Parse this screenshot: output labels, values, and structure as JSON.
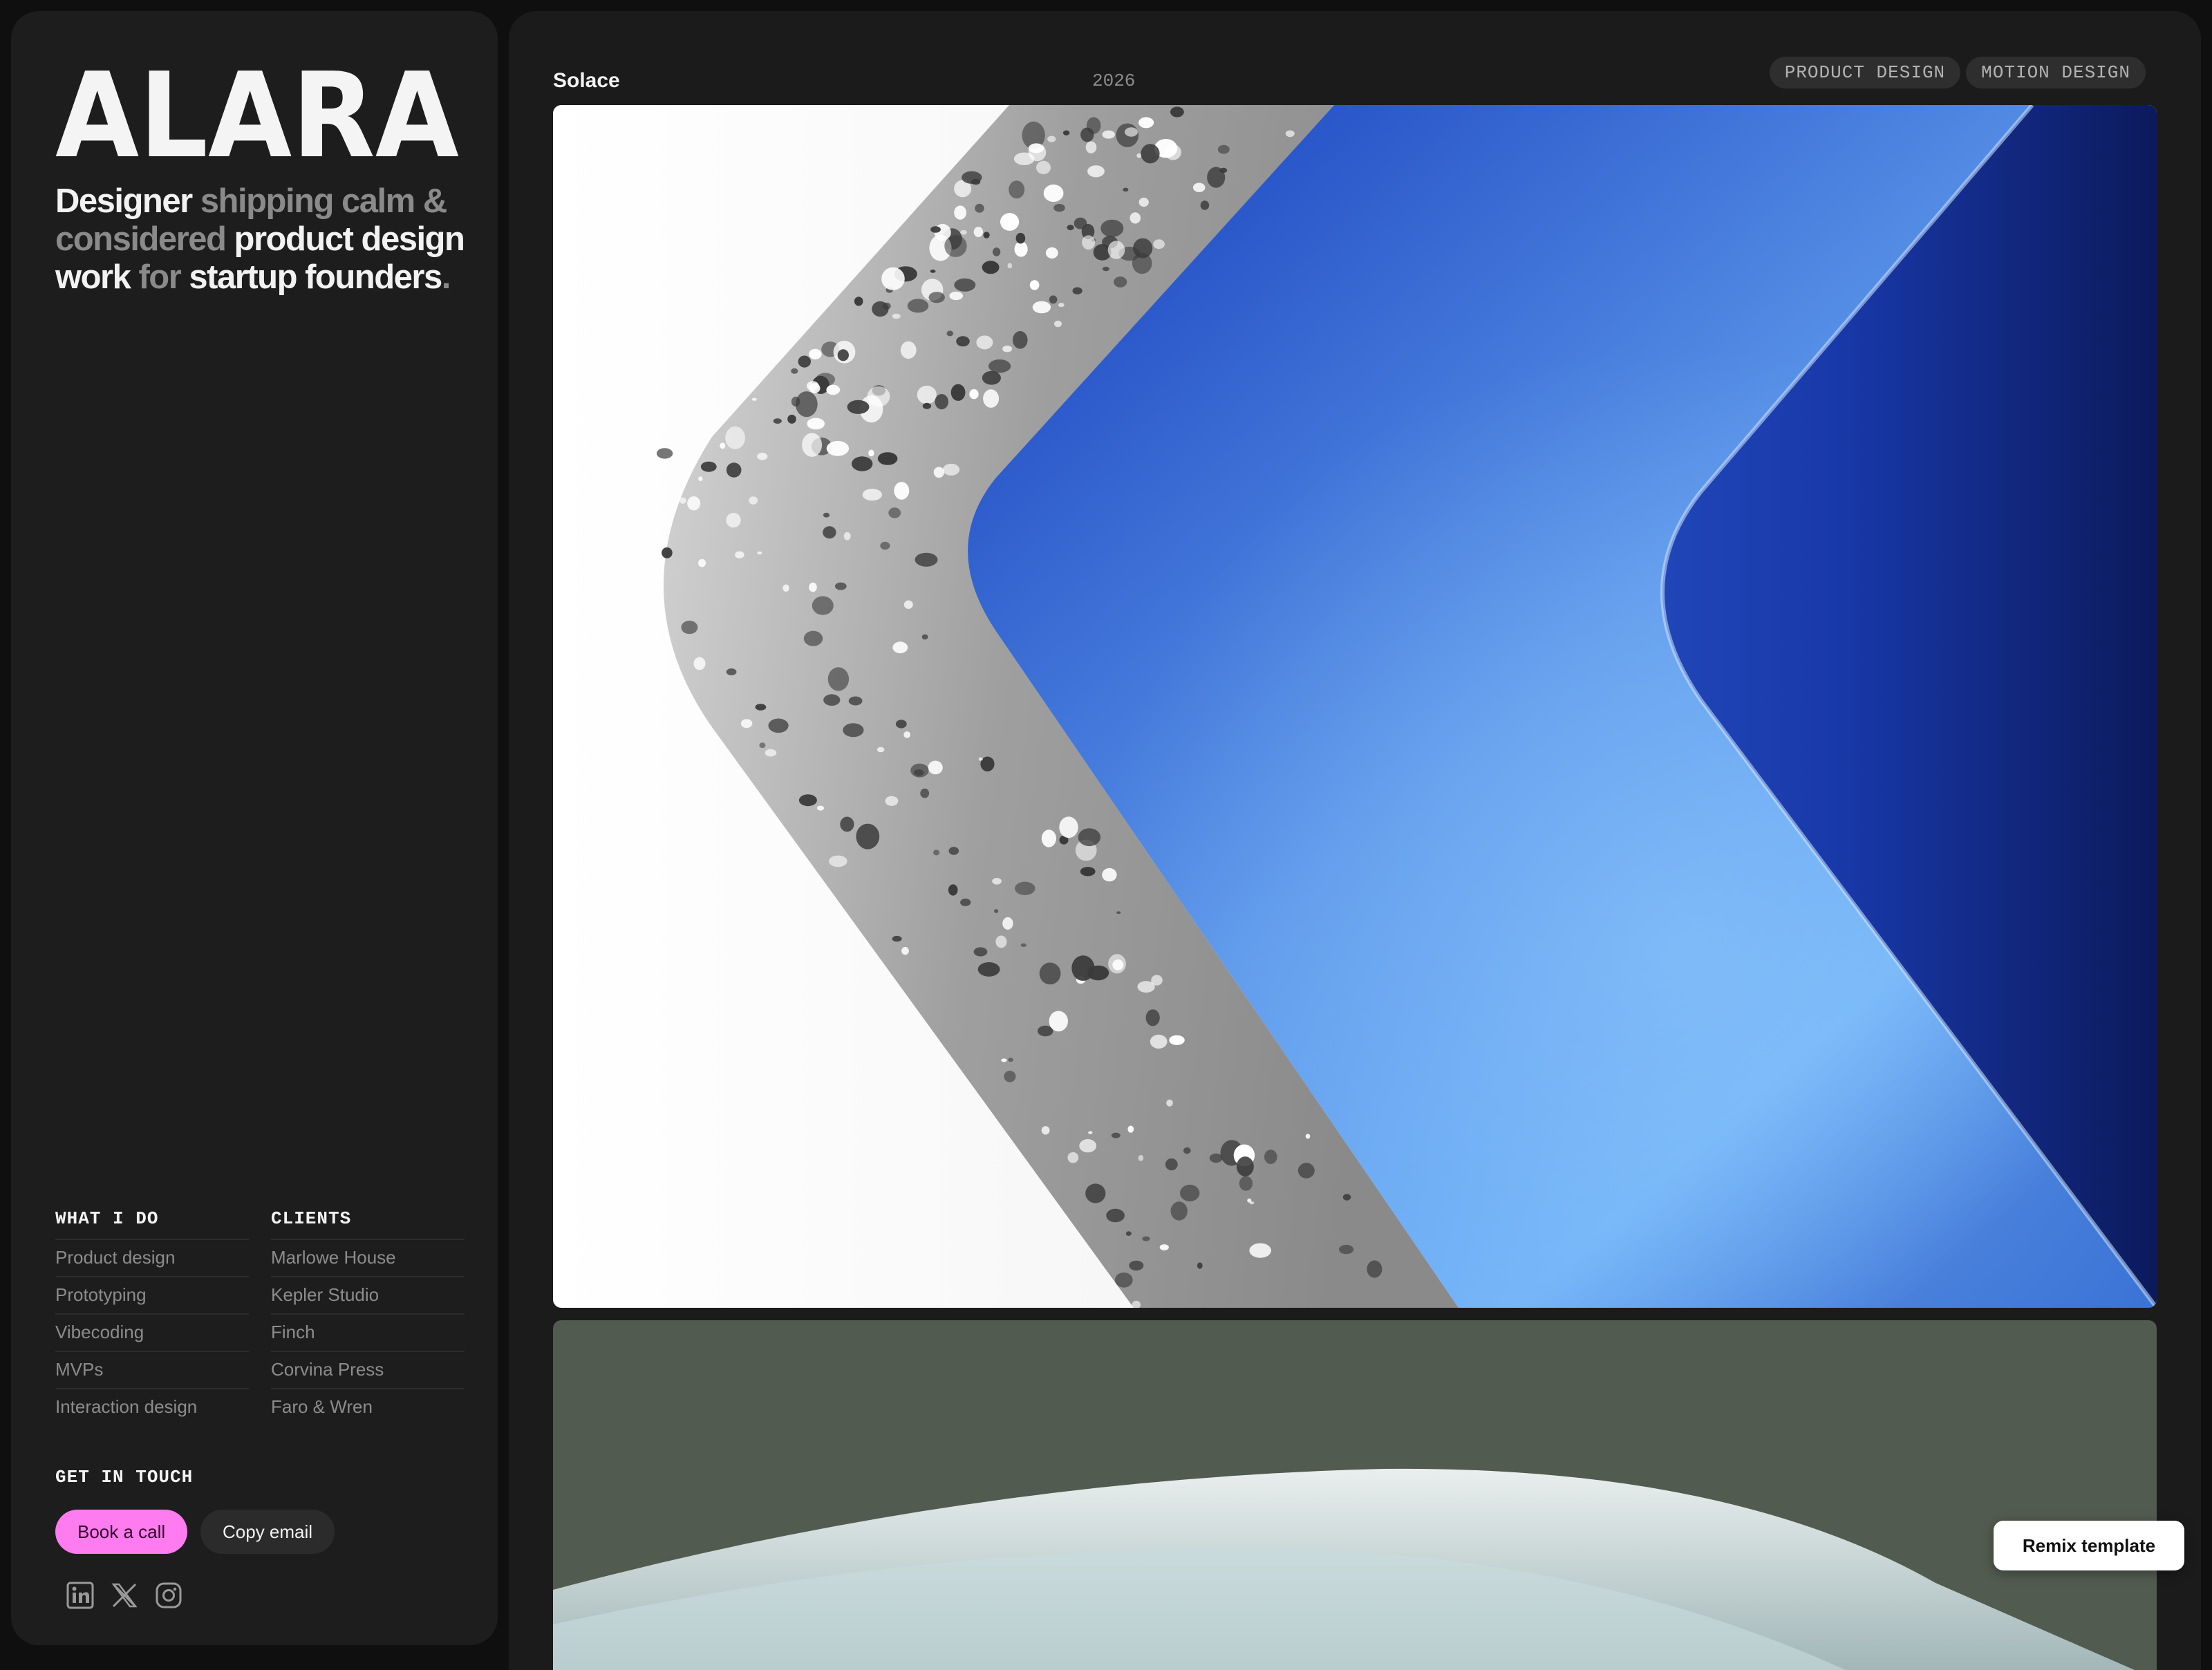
{
  "sidebar": {
    "logo_text": "ALARA",
    "tagline": [
      {
        "text": "Designer",
        "dim": false
      },
      {
        "text": " shipping calm & considered",
        "dim": true
      },
      {
        "text": " product design work",
        "dim": false
      },
      {
        "text": " for",
        "dim": true
      },
      {
        "text": " startup founders",
        "dim": false
      },
      {
        "text": ".",
        "dim": true
      }
    ],
    "what_i_do": {
      "heading": "WHAT I DO",
      "items": [
        "Product design",
        "Prototyping",
        "Vibecoding",
        "MVPs",
        "Interaction design"
      ]
    },
    "clients": {
      "heading": "CLIENTS",
      "items": [
        "Marlowe House",
        "Kepler Studio",
        "Finch",
        "Corvina Press",
        "Faro & Wren"
      ]
    },
    "get_in_touch": {
      "heading": "GET IN TOUCH",
      "book_label": "Book a call",
      "copy_label": "Copy email"
    },
    "socials": [
      "linkedin-icon",
      "x-icon",
      "instagram-icon"
    ]
  },
  "main": {
    "project": {
      "title": "Solace",
      "year": "2026",
      "tags": [
        "PRODUCT DESIGN",
        "MOTION DESIGN"
      ]
    }
  },
  "remix_label": "Remix template",
  "colors": {
    "accent_pink": "#ff7bf0",
    "sidebar_bg": "#1d1d1d",
    "main_bg": "#1b1b1b"
  }
}
